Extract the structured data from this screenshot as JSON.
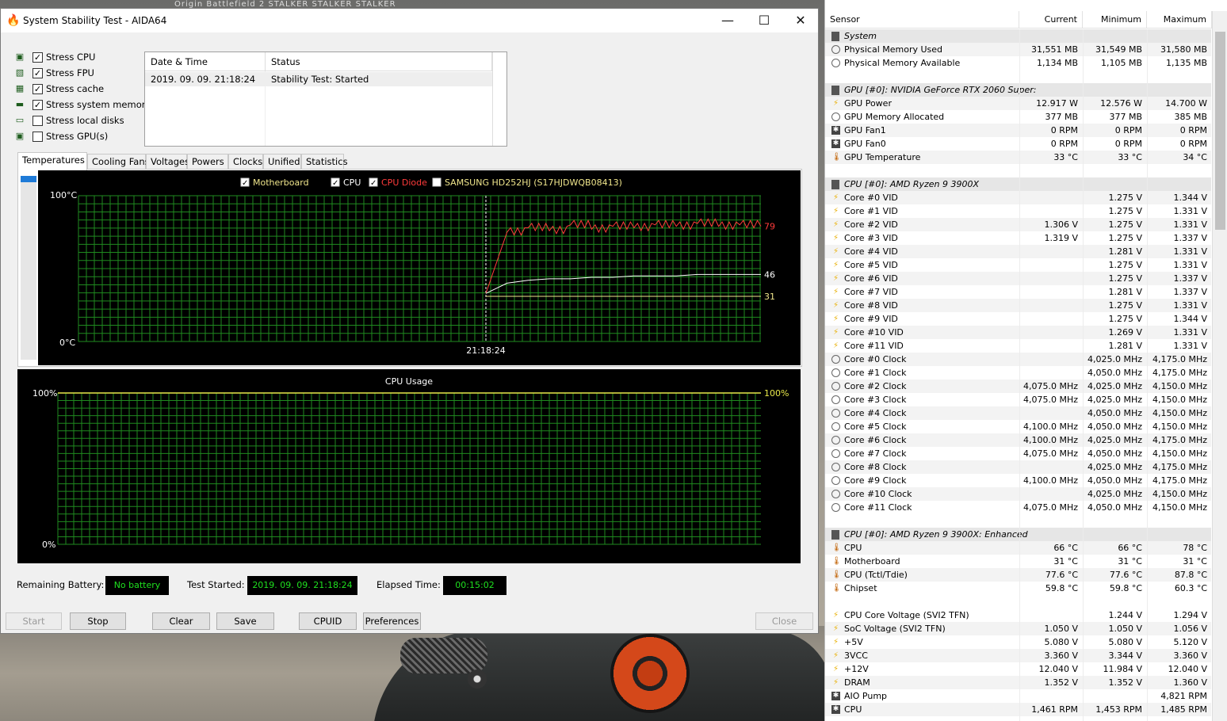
{
  "wallpaper": {
    "tabs": "Origin    Battlefield 2    STALKER STALKER STALKER"
  },
  "window": {
    "title": "System Stability Test - AIDA64",
    "minimize": "—",
    "maximize": "☐",
    "close": "✕"
  },
  "stress": [
    {
      "label": "Stress CPU",
      "checked": true,
      "icon": "cpu-chip-icon",
      "glyph": "▣"
    },
    {
      "label": "Stress FPU",
      "checked": true,
      "icon": "fpu-icon",
      "glyph": "▧"
    },
    {
      "label": "Stress cache",
      "checked": true,
      "icon": "cache-icon",
      "glyph": "▦"
    },
    {
      "label": "Stress system memory",
      "checked": true,
      "icon": "memory-module-icon",
      "glyph": "▬"
    },
    {
      "label": "Stress local disks",
      "checked": false,
      "icon": "hard-disk-icon",
      "glyph": "▭"
    },
    {
      "label": "Stress GPU(s)",
      "checked": false,
      "icon": "monitor-icon",
      "glyph": "▣"
    }
  ],
  "log": {
    "headers": [
      "Date & Time",
      "Status"
    ],
    "rows": [
      [
        "2019. 09. 09. 21:18:24",
        "Stability Test: Started"
      ]
    ]
  },
  "tabs": [
    "Temperatures",
    "Cooling Fans",
    "Voltages",
    "Powers",
    "Clocks",
    "Unified",
    "Statistics"
  ],
  "temp_graph": {
    "legend": [
      {
        "label": "Motherboard",
        "color": "#f0e68c",
        "checked": true
      },
      {
        "label": "CPU",
        "color": "#ffffff",
        "checked": true
      },
      {
        "label": "CPU Diode",
        "color": "#ff3b3b",
        "checked": true
      },
      {
        "label": "SAMSUNG HD252HJ (S17HJDWQB08413)",
        "color": "#f0e68c",
        "checked": false
      }
    ],
    "y_top": "100°C",
    "y_bottom": "0°C",
    "time_label": "21:18:24",
    "end_values": [
      "79",
      "46",
      "31"
    ]
  },
  "cpu_graph": {
    "title": "CPU Usage",
    "y_top": "100%",
    "y_bottom": "0%",
    "current": "100%"
  },
  "chart_data": [
    {
      "type": "line",
      "title": "",
      "ylim": [
        0,
        100
      ],
      "xlabel": "",
      "ylabel": "",
      "x_marker": "21:18:24",
      "series": [
        {
          "name": "CPU Diode",
          "color": "#ff3b3b",
          "start_value": 33,
          "values": [
            33,
            75,
            78,
            76,
            80,
            77,
            79,
            78,
            80,
            79,
            81,
            79,
            80,
            79
          ]
        },
        {
          "name": "CPU",
          "color": "#ffffff",
          "start_value": 33,
          "values": [
            33,
            40,
            42,
            43,
            43,
            44,
            44,
            45,
            45,
            45,
            46,
            46,
            46,
            46
          ]
        },
        {
          "name": "Motherboard",
          "color": "#f0e68c",
          "start_value": 31,
          "values": [
            31,
            31,
            31,
            31,
            31,
            31,
            31,
            31,
            31,
            31,
            31,
            31,
            31,
            31
          ]
        }
      ]
    },
    {
      "type": "line",
      "title": "CPU Usage",
      "ylim": [
        0,
        100
      ],
      "series": [
        {
          "name": "CPU Usage",
          "color": "#e8e84a",
          "values": [
            100,
            100,
            100,
            100,
            100,
            100,
            100,
            100
          ]
        }
      ]
    }
  ],
  "status": {
    "battery_label": "Remaining Battery:",
    "battery_value": "No battery",
    "started_label": "Test Started:",
    "started_value": "2019. 09. 09. 21:18:24",
    "elapsed_label": "Elapsed Time:",
    "elapsed_value": "00:15:02"
  },
  "buttons": {
    "start": "Start",
    "stop": "Stop",
    "clear": "Clear",
    "save": "Save",
    "cpuid": "CPUID",
    "preferences": "Preferences",
    "close": "Close"
  },
  "sensor_panel": {
    "headers": [
      "Sensor",
      "Current",
      "Minimum",
      "Maximum"
    ],
    "rows": [
      {
        "kind": "group",
        "name": "System"
      },
      {
        "kind": "clock",
        "name": "Physical Memory Used",
        "cur": "31,551 MB",
        "min": "31,549 MB",
        "max": "31,580 MB"
      },
      {
        "kind": "clock",
        "name": "Physical Memory Available",
        "cur": "1,134 MB",
        "min": "1,105 MB",
        "max": "1,135 MB"
      },
      {
        "kind": "blank"
      },
      {
        "kind": "group",
        "name": "GPU [#0]: NVIDIA GeForce RTX 2060 Super:"
      },
      {
        "kind": "volt",
        "name": "GPU Power",
        "cur": "12.917 W",
        "min": "12.576 W",
        "max": "14.700 W"
      },
      {
        "kind": "clock",
        "name": "GPU Memory Allocated",
        "cur": "377 MB",
        "min": "377 MB",
        "max": "385 MB"
      },
      {
        "kind": "fan",
        "name": "GPU Fan1",
        "cur": "0 RPM",
        "min": "0 RPM",
        "max": "0 RPM"
      },
      {
        "kind": "fan",
        "name": "GPU Fan0",
        "cur": "0 RPM",
        "min": "0 RPM",
        "max": "0 RPM"
      },
      {
        "kind": "temp",
        "name": "GPU Temperature",
        "cur": "33 °C",
        "min": "33 °C",
        "max": "34 °C"
      },
      {
        "kind": "blank"
      },
      {
        "kind": "group",
        "name": "CPU [#0]: AMD Ryzen 9 3900X"
      },
      {
        "kind": "volt",
        "name": "Core #0 VID",
        "cur": "",
        "min": "1.275 V",
        "max": "1.344 V"
      },
      {
        "kind": "volt",
        "name": "Core #1 VID",
        "cur": "",
        "min": "1.275 V",
        "max": "1.331 V"
      },
      {
        "kind": "volt",
        "name": "Core #2 VID",
        "cur": "1.306 V",
        "min": "1.275 V",
        "max": "1.331 V"
      },
      {
        "kind": "volt",
        "name": "Core #3 VID",
        "cur": "1.319 V",
        "min": "1.275 V",
        "max": "1.337 V"
      },
      {
        "kind": "volt",
        "name": "Core #4 VID",
        "cur": "",
        "min": "1.281 V",
        "max": "1.331 V"
      },
      {
        "kind": "volt",
        "name": "Core #5 VID",
        "cur": "",
        "min": "1.275 V",
        "max": "1.331 V"
      },
      {
        "kind": "volt",
        "name": "Core #6 VID",
        "cur": "",
        "min": "1.275 V",
        "max": "1.337 V"
      },
      {
        "kind": "volt",
        "name": "Core #7 VID",
        "cur": "",
        "min": "1.281 V",
        "max": "1.337 V"
      },
      {
        "kind": "volt",
        "name": "Core #8 VID",
        "cur": "",
        "min": "1.275 V",
        "max": "1.331 V"
      },
      {
        "kind": "volt",
        "name": "Core #9 VID",
        "cur": "",
        "min": "1.275 V",
        "max": "1.344 V"
      },
      {
        "kind": "volt",
        "name": "Core #10 VID",
        "cur": "",
        "min": "1.269 V",
        "max": "1.331 V"
      },
      {
        "kind": "volt",
        "name": "Core #11 VID",
        "cur": "",
        "min": "1.281 V",
        "max": "1.331 V"
      },
      {
        "kind": "clock",
        "name": "Core #0 Clock",
        "cur": "",
        "min": "4,025.0 MHz",
        "max": "4,175.0 MHz"
      },
      {
        "kind": "clock",
        "name": "Core #1 Clock",
        "cur": "",
        "min": "4,050.0 MHz",
        "max": "4,175.0 MHz"
      },
      {
        "kind": "clock",
        "name": "Core #2 Clock",
        "cur": "4,075.0 MHz",
        "min": "4,025.0 MHz",
        "max": "4,150.0 MHz"
      },
      {
        "kind": "clock",
        "name": "Core #3 Clock",
        "cur": "4,075.0 MHz",
        "min": "4,025.0 MHz",
        "max": "4,150.0 MHz"
      },
      {
        "kind": "clock",
        "name": "Core #4 Clock",
        "cur": "",
        "min": "4,050.0 MHz",
        "max": "4,150.0 MHz"
      },
      {
        "kind": "clock",
        "name": "Core #5 Clock",
        "cur": "4,100.0 MHz",
        "min": "4,050.0 MHz",
        "max": "4,150.0 MHz"
      },
      {
        "kind": "clock",
        "name": "Core #6 Clock",
        "cur": "4,100.0 MHz",
        "min": "4,025.0 MHz",
        "max": "4,175.0 MHz"
      },
      {
        "kind": "clock",
        "name": "Core #7 Clock",
        "cur": "4,075.0 MHz",
        "min": "4,050.0 MHz",
        "max": "4,150.0 MHz"
      },
      {
        "kind": "clock",
        "name": "Core #8 Clock",
        "cur": "",
        "min": "4,025.0 MHz",
        "max": "4,175.0 MHz"
      },
      {
        "kind": "clock",
        "name": "Core #9 Clock",
        "cur": "4,100.0 MHz",
        "min": "4,050.0 MHz",
        "max": "4,175.0 MHz"
      },
      {
        "kind": "clock",
        "name": "Core #10 Clock",
        "cur": "",
        "min": "4,025.0 MHz",
        "max": "4,150.0 MHz"
      },
      {
        "kind": "clock",
        "name": "Core #11 Clock",
        "cur": "4,075.0 MHz",
        "min": "4,050.0 MHz",
        "max": "4,150.0 MHz"
      },
      {
        "kind": "blank"
      },
      {
        "kind": "group",
        "name": "CPU [#0]: AMD Ryzen 9 3900X: Enhanced"
      },
      {
        "kind": "temp",
        "name": "CPU",
        "cur": "66 °C",
        "min": "66 °C",
        "max": "78 °C"
      },
      {
        "kind": "temp",
        "name": "Motherboard",
        "cur": "31 °C",
        "min": "31 °C",
        "max": "31 °C"
      },
      {
        "kind": "temp",
        "name": "CPU (Tctl/Tdie)",
        "cur": "77.6 °C",
        "min": "77.6 °C",
        "max": "87.8 °C"
      },
      {
        "kind": "temp",
        "name": "Chipset",
        "cur": "59.8 °C",
        "min": "59.8 °C",
        "max": "60.3 °C"
      },
      {
        "kind": "blank"
      },
      {
        "kind": "volt",
        "name": "CPU Core Voltage (SVI2 TFN)",
        "cur": "",
        "min": "1.244 V",
        "max": "1.294 V"
      },
      {
        "kind": "volt",
        "name": "SoC Voltage (SVI2 TFN)",
        "cur": "1.050 V",
        "min": "1.050 V",
        "max": "1.056 V"
      },
      {
        "kind": "volt",
        "name": "+5V",
        "cur": "5.080 V",
        "min": "5.080 V",
        "max": "5.120 V"
      },
      {
        "kind": "volt",
        "name": "3VCC",
        "cur": "3.360 V",
        "min": "3.344 V",
        "max": "3.360 V"
      },
      {
        "kind": "volt",
        "name": "+12V",
        "cur": "12.040 V",
        "min": "11.984 V",
        "max": "12.040 V"
      },
      {
        "kind": "volt",
        "name": "DRAM",
        "cur": "1.352 V",
        "min": "1.352 V",
        "max": "1.360 V"
      },
      {
        "kind": "fan",
        "name": "AIO Pump",
        "cur": "",
        "min": "",
        "max": "4,821 RPM"
      },
      {
        "kind": "fan",
        "name": "CPU",
        "cur": "1,461 RPM",
        "min": "1,453 RPM",
        "max": "1,485 RPM"
      }
    ]
  }
}
